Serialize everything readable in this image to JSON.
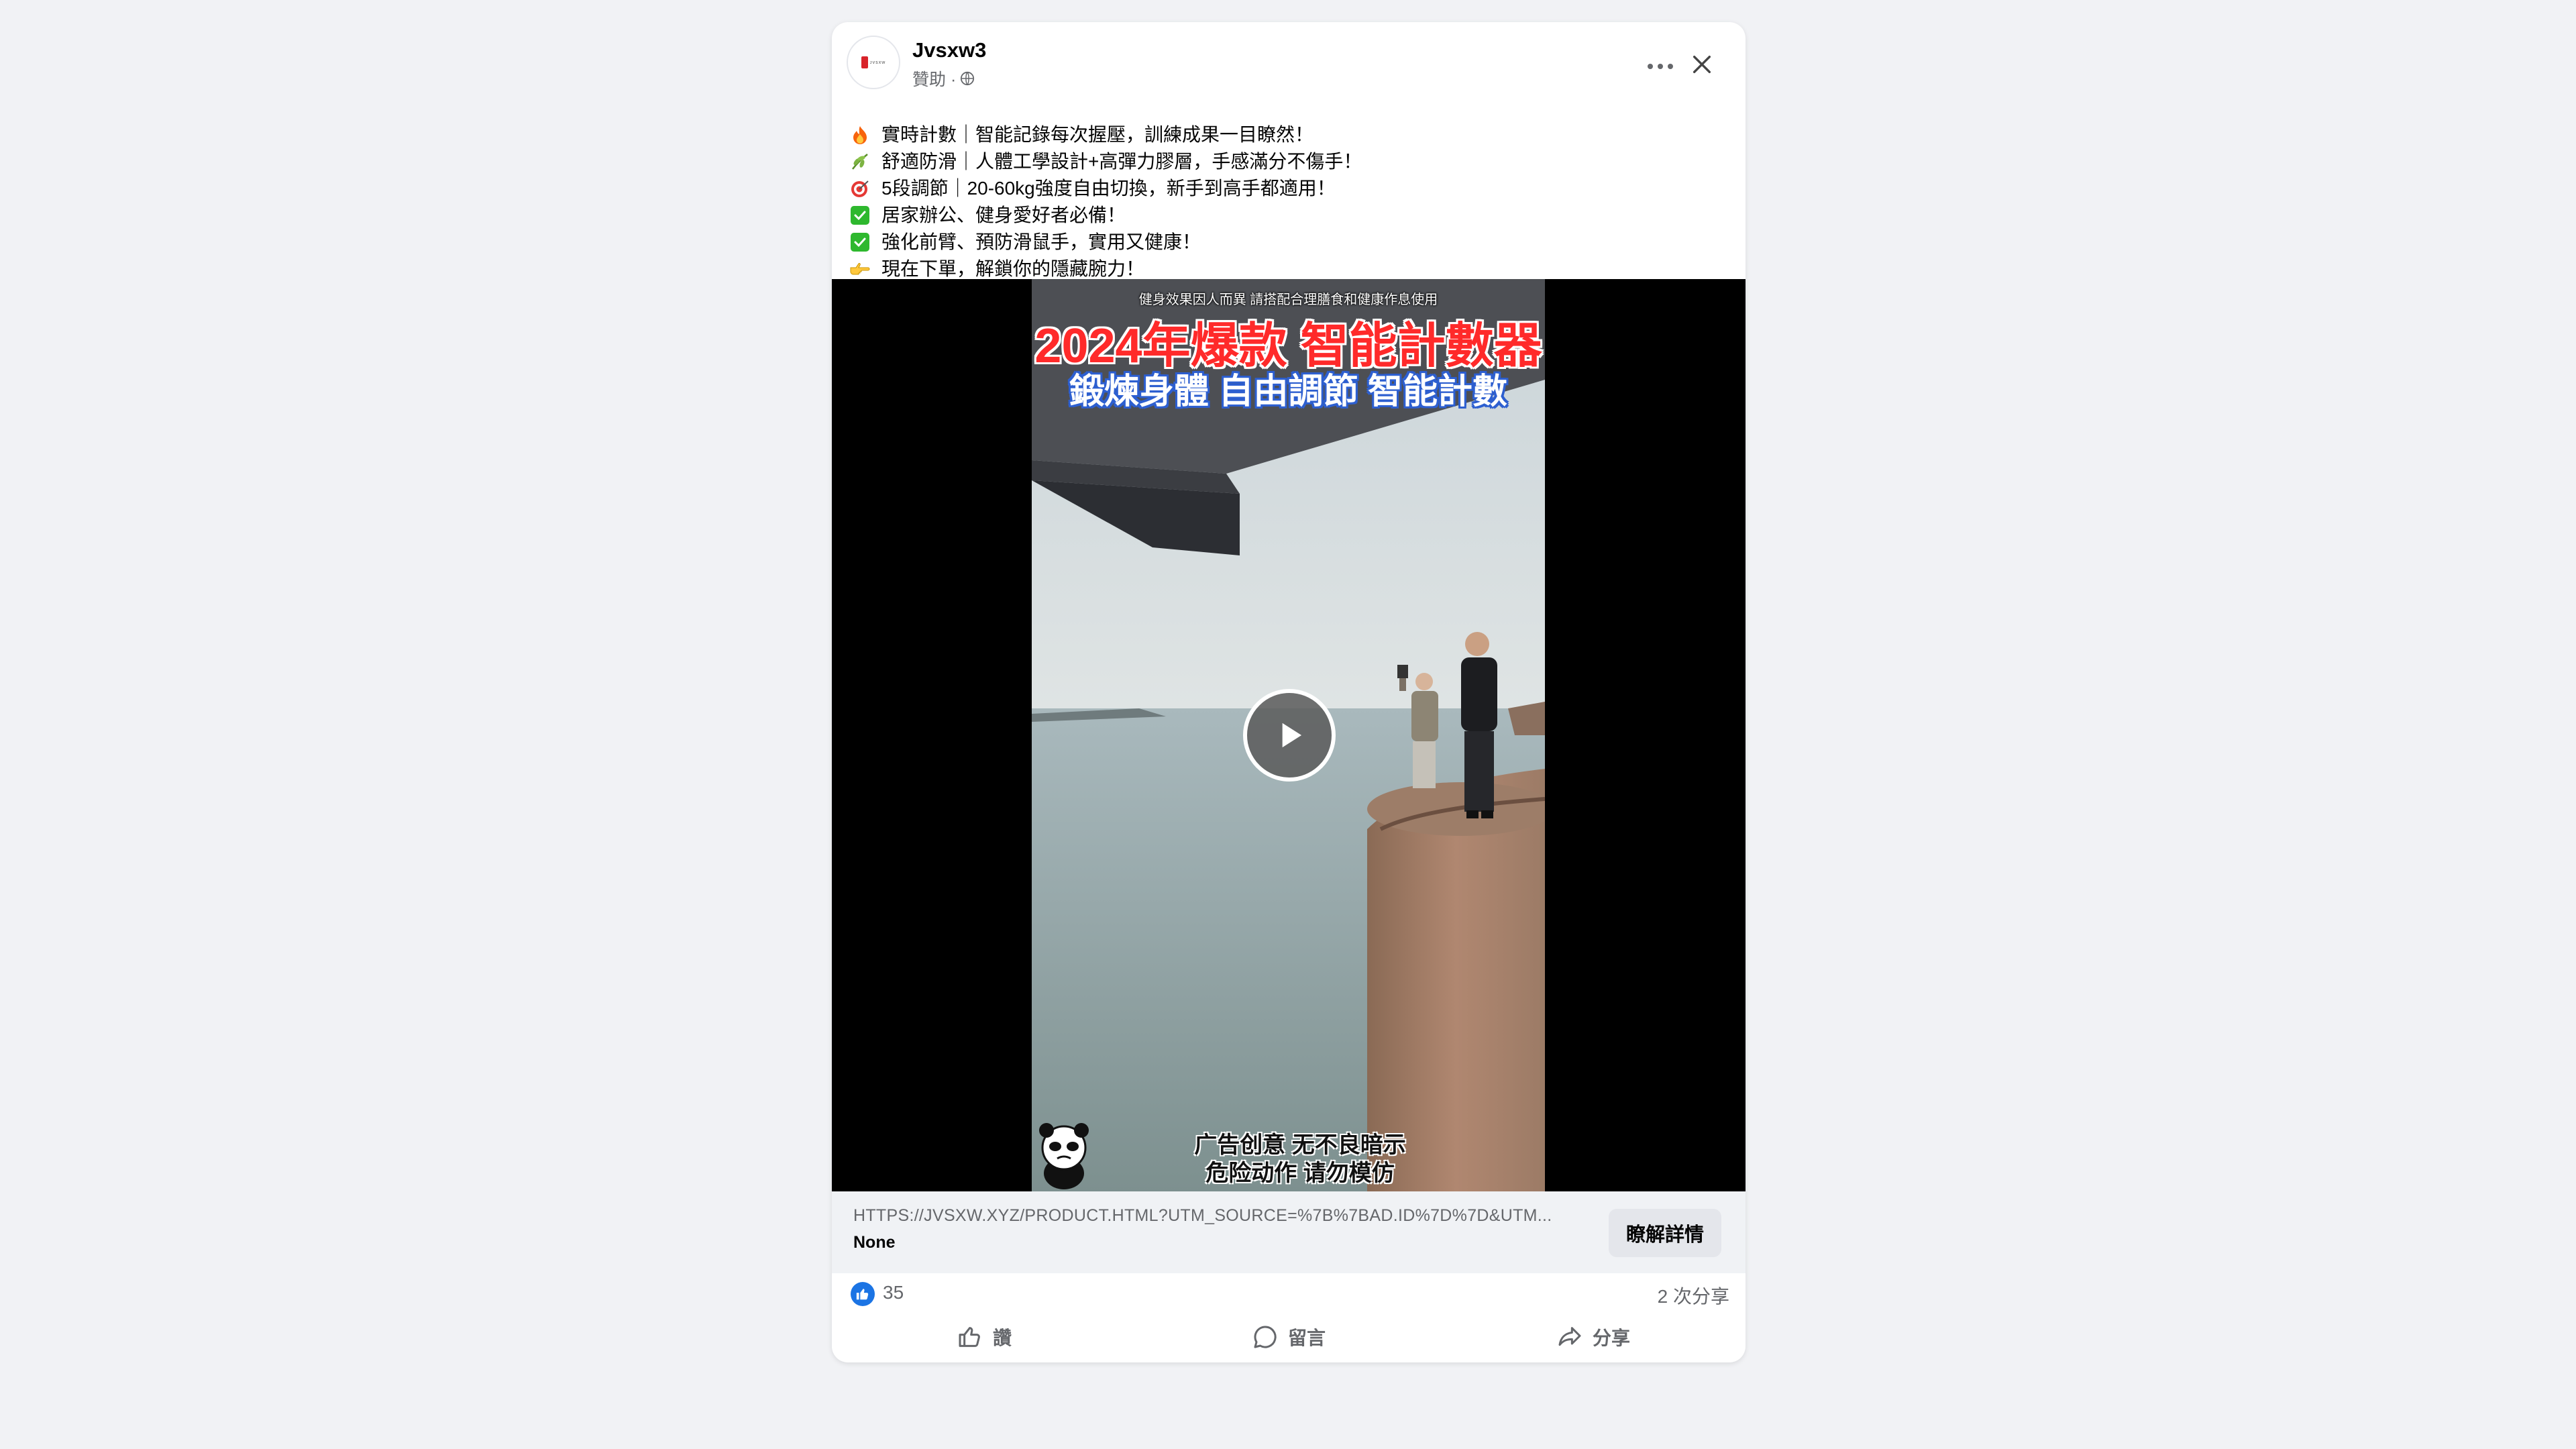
{
  "post": {
    "page_name": "Jvsxw3",
    "sponsored_label": "贊助 ·",
    "avatar_logo_text": "ᴊᴠꜱxᴡ",
    "menu_icon": "more-horizontal-icon",
    "close_icon": "close-icon",
    "text_lines": [
      {
        "icon": "fire-emoji",
        "text": "實時計數｜智能記錄每次握壓，訓練成果一目瞭然！"
      },
      {
        "icon": "herb-emoji",
        "text": "舒適防滑｜人體工學設計+高彈力膠層，手感滿分不傷手！"
      },
      {
        "icon": "target-emoji",
        "text": "5段調節｜20-60kg強度自由切換，新手到高手都適用！"
      },
      {
        "icon": "check-mark-emoji",
        "text": "居家辦公、健身愛好者必備！"
      },
      {
        "icon": "check-mark-emoji",
        "text": "強化前臂、預防滑鼠手，實用又健康！"
      },
      {
        "icon": "pointing-hand-emoji",
        "text": "現在下單，解鎖你的隱藏腕力！"
      }
    ]
  },
  "video": {
    "overlay_note": "健身效果因人而異 請搭配合理膳食和健康作息使用",
    "headline": "2024年爆款 智能計數器",
    "subheadline": "鍛煉身體 自由調節 智能計數",
    "disclaimer_line1": "广告创意 无不良暗示",
    "disclaimer_line2": "危险动作 请勿模仿",
    "play_icon": "play-icon"
  },
  "link": {
    "url": "HTTPS://JVSXW.XYZ/PRODUCT.HTML?UTM_SOURCE=%7B%7BAD.ID%7D%7D&UTM...",
    "title": "None",
    "cta_label": "瞭解詳情"
  },
  "stats": {
    "like_count": "35",
    "shares": "2 次分享"
  },
  "actions": {
    "like": "讚",
    "comment": "留言",
    "share": "分享"
  },
  "colors": {
    "page_bg": "#f1f2f5",
    "card_bg": "#ffffff",
    "accent_blue": "#1b74e4",
    "secondary_text": "#65676b",
    "headline_red": "#ff2a2a",
    "subheadline_blue": "#2d5fd0"
  }
}
